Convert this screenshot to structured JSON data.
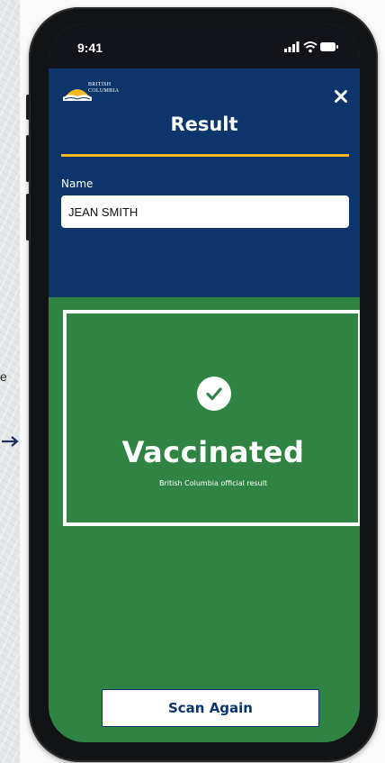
{
  "status_bar": {
    "time": "9:41"
  },
  "header": {
    "logo_text_line1": "BRITISH",
    "logo_text_line2": "COLUMBIA",
    "title": "Result"
  },
  "form": {
    "name_label": "Name",
    "name_value": "JEAN SMITH"
  },
  "result": {
    "status": "Vaccinated",
    "subtitle": "British Columbia official result"
  },
  "actions": {
    "scan_again_label": "Scan Again"
  },
  "side": {
    "text_fragment": "e"
  },
  "colors": {
    "header_bg": "#0b356b",
    "accent_gold": "#f4b820",
    "result_green": "#2f8444",
    "button_text": "#0b356b"
  },
  "icons": [
    "signal-icon",
    "wifi-icon",
    "battery-icon",
    "close-icon",
    "check-circle-icon",
    "arrow-right-icon",
    "bc-logo-icon"
  ]
}
